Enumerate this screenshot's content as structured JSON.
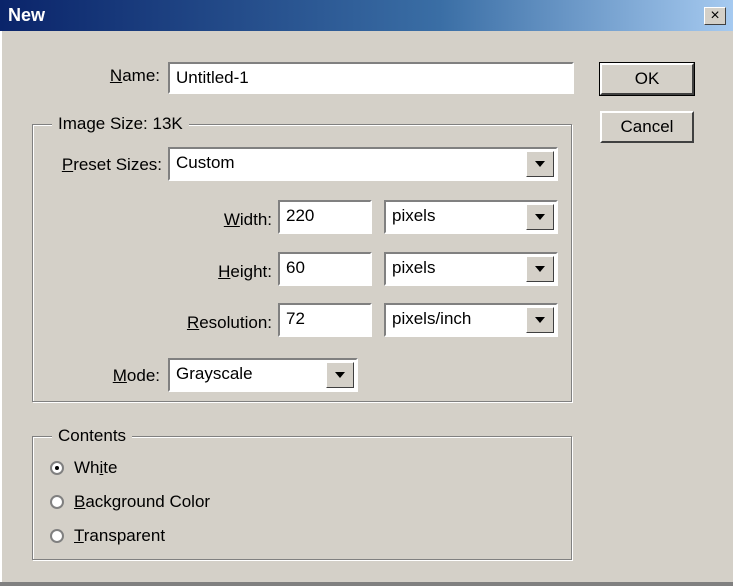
{
  "window": {
    "title": "New",
    "close_glyph": "×"
  },
  "name_field": {
    "label": "Name:",
    "value": "Untitled-1"
  },
  "buttons": {
    "ok": "OK",
    "cancel": "Cancel"
  },
  "image_size": {
    "legend": "Image Size: 13K",
    "preset": {
      "label": "Preset Sizes:",
      "value": "Custom"
    },
    "width": {
      "label": "Width:",
      "value": "220",
      "unit": "pixels"
    },
    "height": {
      "label": "Height:",
      "value": "60",
      "unit": "pixels"
    },
    "resolution": {
      "label": "Resolution:",
      "value": "72",
      "unit": "pixels/inch"
    },
    "mode": {
      "label": "Mode:",
      "value": "Grayscale"
    }
  },
  "contents": {
    "legend": "Contents",
    "options": [
      {
        "label": "White",
        "selected": true
      },
      {
        "label": "Background Color",
        "selected": false
      },
      {
        "label": "Transparent",
        "selected": false
      }
    ]
  },
  "colors": {
    "titlebar_start": "#0a246a",
    "titlebar_end": "#a6caf0",
    "face": "#d4d0c8"
  }
}
